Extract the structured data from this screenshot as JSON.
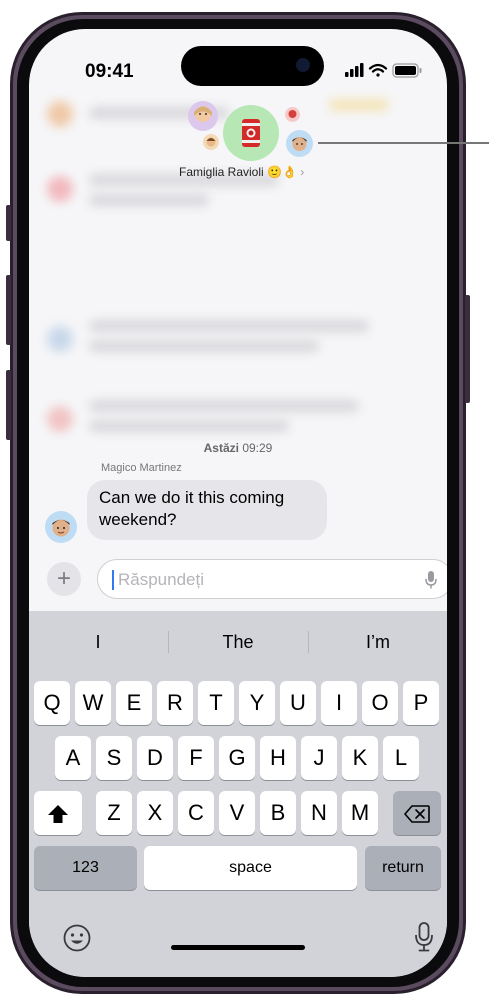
{
  "status_bar": {
    "time": "09:41"
  },
  "conversation": {
    "group_name": "Famiglia Ravioli 🙂👌",
    "chevron": "›",
    "timestamp_day": "Astăzi",
    "timestamp_time": "09:29",
    "message": {
      "sender": "Magico Martinez",
      "text_line1": "Can we do it this coming",
      "text_line2": "weekend?"
    }
  },
  "composer": {
    "add_label": "+",
    "placeholder": "Răspundeți"
  },
  "keyboard": {
    "suggestions": [
      "I",
      "The",
      "I’m"
    ],
    "row1": [
      "Q",
      "W",
      "E",
      "R",
      "T",
      "Y",
      "U",
      "I",
      "O",
      "P"
    ],
    "row2": [
      "A",
      "S",
      "D",
      "F",
      "G",
      "H",
      "J",
      "K",
      "L"
    ],
    "row3": [
      "Z",
      "X",
      "C",
      "V",
      "B",
      "N",
      "M"
    ],
    "numbers_label": "123",
    "space_label": "space",
    "return_label": "return"
  },
  "icons": [
    "signal-icon",
    "wifi-icon",
    "battery-icon",
    "microphone-icon",
    "shift-icon",
    "delete-icon",
    "emoji-icon",
    "dictation-icon",
    "plus-icon"
  ],
  "colors": {
    "accent": "#3478f6",
    "bubble": "#e6e6ea",
    "keyboard": "#d1d3d9",
    "frame": "#2a1f2c"
  }
}
